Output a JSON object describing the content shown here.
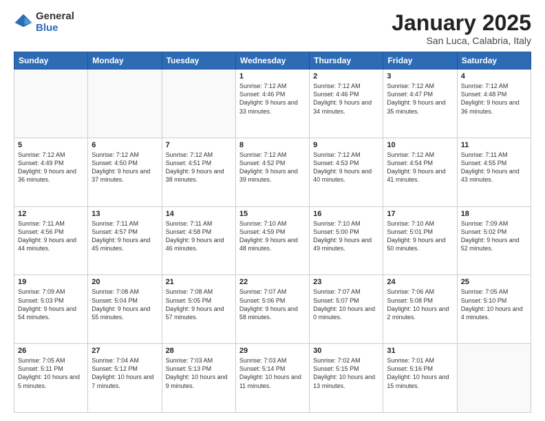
{
  "logo": {
    "general": "General",
    "blue": "Blue"
  },
  "title": "January 2025",
  "location": "San Luca, Calabria, Italy",
  "weekdays": [
    "Sunday",
    "Monday",
    "Tuesday",
    "Wednesday",
    "Thursday",
    "Friday",
    "Saturday"
  ],
  "weeks": [
    [
      {
        "day": "",
        "info": ""
      },
      {
        "day": "",
        "info": ""
      },
      {
        "day": "",
        "info": ""
      },
      {
        "day": "1",
        "info": "Sunrise: 7:12 AM\nSunset: 4:46 PM\nDaylight: 9 hours and 33 minutes."
      },
      {
        "day": "2",
        "info": "Sunrise: 7:12 AM\nSunset: 4:46 PM\nDaylight: 9 hours and 34 minutes."
      },
      {
        "day": "3",
        "info": "Sunrise: 7:12 AM\nSunset: 4:47 PM\nDaylight: 9 hours and 35 minutes."
      },
      {
        "day": "4",
        "info": "Sunrise: 7:12 AM\nSunset: 4:48 PM\nDaylight: 9 hours and 36 minutes."
      }
    ],
    [
      {
        "day": "5",
        "info": "Sunrise: 7:12 AM\nSunset: 4:49 PM\nDaylight: 9 hours and 36 minutes."
      },
      {
        "day": "6",
        "info": "Sunrise: 7:12 AM\nSunset: 4:50 PM\nDaylight: 9 hours and 37 minutes."
      },
      {
        "day": "7",
        "info": "Sunrise: 7:12 AM\nSunset: 4:51 PM\nDaylight: 9 hours and 38 minutes."
      },
      {
        "day": "8",
        "info": "Sunrise: 7:12 AM\nSunset: 4:52 PM\nDaylight: 9 hours and 39 minutes."
      },
      {
        "day": "9",
        "info": "Sunrise: 7:12 AM\nSunset: 4:53 PM\nDaylight: 9 hours and 40 minutes."
      },
      {
        "day": "10",
        "info": "Sunrise: 7:12 AM\nSunset: 4:54 PM\nDaylight: 9 hours and 41 minutes."
      },
      {
        "day": "11",
        "info": "Sunrise: 7:11 AM\nSunset: 4:55 PM\nDaylight: 9 hours and 43 minutes."
      }
    ],
    [
      {
        "day": "12",
        "info": "Sunrise: 7:11 AM\nSunset: 4:56 PM\nDaylight: 9 hours and 44 minutes."
      },
      {
        "day": "13",
        "info": "Sunrise: 7:11 AM\nSunset: 4:57 PM\nDaylight: 9 hours and 45 minutes."
      },
      {
        "day": "14",
        "info": "Sunrise: 7:11 AM\nSunset: 4:58 PM\nDaylight: 9 hours and 46 minutes."
      },
      {
        "day": "15",
        "info": "Sunrise: 7:10 AM\nSunset: 4:59 PM\nDaylight: 9 hours and 48 minutes."
      },
      {
        "day": "16",
        "info": "Sunrise: 7:10 AM\nSunset: 5:00 PM\nDaylight: 9 hours and 49 minutes."
      },
      {
        "day": "17",
        "info": "Sunrise: 7:10 AM\nSunset: 5:01 PM\nDaylight: 9 hours and 50 minutes."
      },
      {
        "day": "18",
        "info": "Sunrise: 7:09 AM\nSunset: 5:02 PM\nDaylight: 9 hours and 52 minutes."
      }
    ],
    [
      {
        "day": "19",
        "info": "Sunrise: 7:09 AM\nSunset: 5:03 PM\nDaylight: 9 hours and 54 minutes."
      },
      {
        "day": "20",
        "info": "Sunrise: 7:08 AM\nSunset: 5:04 PM\nDaylight: 9 hours and 55 minutes."
      },
      {
        "day": "21",
        "info": "Sunrise: 7:08 AM\nSunset: 5:05 PM\nDaylight: 9 hours and 57 minutes."
      },
      {
        "day": "22",
        "info": "Sunrise: 7:07 AM\nSunset: 5:06 PM\nDaylight: 9 hours and 58 minutes."
      },
      {
        "day": "23",
        "info": "Sunrise: 7:07 AM\nSunset: 5:07 PM\nDaylight: 10 hours and 0 minutes."
      },
      {
        "day": "24",
        "info": "Sunrise: 7:06 AM\nSunset: 5:08 PM\nDaylight: 10 hours and 2 minutes."
      },
      {
        "day": "25",
        "info": "Sunrise: 7:05 AM\nSunset: 5:10 PM\nDaylight: 10 hours and 4 minutes."
      }
    ],
    [
      {
        "day": "26",
        "info": "Sunrise: 7:05 AM\nSunset: 5:11 PM\nDaylight: 10 hours and 5 minutes."
      },
      {
        "day": "27",
        "info": "Sunrise: 7:04 AM\nSunset: 5:12 PM\nDaylight: 10 hours and 7 minutes."
      },
      {
        "day": "28",
        "info": "Sunrise: 7:03 AM\nSunset: 5:13 PM\nDaylight: 10 hours and 9 minutes."
      },
      {
        "day": "29",
        "info": "Sunrise: 7:03 AM\nSunset: 5:14 PM\nDaylight: 10 hours and 11 minutes."
      },
      {
        "day": "30",
        "info": "Sunrise: 7:02 AM\nSunset: 5:15 PM\nDaylight: 10 hours and 13 minutes."
      },
      {
        "day": "31",
        "info": "Sunrise: 7:01 AM\nSunset: 5:16 PM\nDaylight: 10 hours and 15 minutes."
      },
      {
        "day": "",
        "info": ""
      }
    ]
  ]
}
